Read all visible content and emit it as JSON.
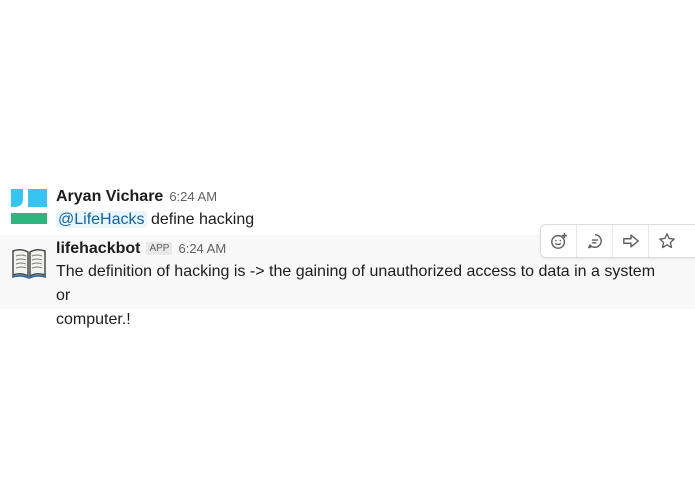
{
  "messages": [
    {
      "sender": "Aryan Vichare",
      "time": "6:24 AM",
      "mention": "@LifeHacks",
      "text": "define hacking",
      "avatar_colors": [
        "#36c5f0",
        "#2eb67d"
      ]
    },
    {
      "sender": "lifehackbot",
      "badge": "APP",
      "time": "6:24 AM",
      "text_line1": "The definition of hacking is -> the gaining of unauthorized access to data in a system or",
      "text_line2": "computer.!",
      "avatar_icon": "open-book-icon"
    }
  ],
  "message_actions": [
    {
      "icon": "add-reaction-icon"
    },
    {
      "icon": "reply-in-thread-icon"
    },
    {
      "icon": "share-message-icon"
    },
    {
      "icon": "save-star-icon"
    }
  ]
}
